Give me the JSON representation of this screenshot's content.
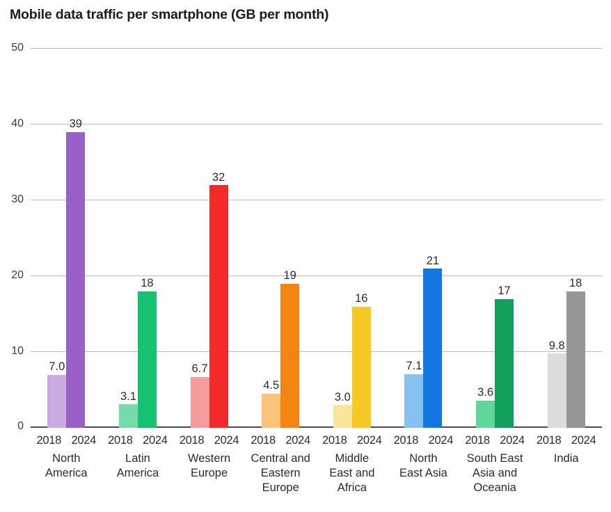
{
  "chart_data": {
    "type": "bar",
    "title": "Mobile data traffic per smartphone (GB per month)",
    "xlabel": "",
    "ylabel": "",
    "ylim": [
      0,
      50
    ],
    "yticks": [
      0,
      10,
      20,
      30,
      40,
      50
    ],
    "ytick_labels": [
      "0",
      "10",
      "20",
      "30",
      "40",
      "50"
    ],
    "grid": true,
    "legend": "none",
    "categories": [
      "North America",
      "Latin America",
      "Western Europe",
      "Central and Eastern Europe",
      "Middle East and Africa",
      "North East Asia",
      "South East Asia and Oceania",
      "India"
    ],
    "series": [
      {
        "name": "2018",
        "values": [
          7.0,
          3.1,
          6.7,
          4.5,
          3.0,
          7.1,
          3.6,
          9.8
        ],
        "labels": [
          "7.0",
          "3.1",
          "6.7",
          "4.5",
          "3.0",
          "7.1",
          "3.6",
          "9.8"
        ]
      },
      {
        "name": "2024",
        "values": [
          39,
          18,
          32,
          19,
          16,
          21,
          17,
          18
        ],
        "labels": [
          "39",
          "18",
          "32",
          "19",
          "16",
          "21",
          "17",
          "18"
        ]
      }
    ],
    "group_colors": [
      {
        "light": "#CBAAE2",
        "dark": "#9B5FC8"
      },
      {
        "light": "#74DCA8",
        "dark": "#16C172"
      },
      {
        "light": "#F79C9C",
        "dark": "#F42A28"
      },
      {
        "light": "#FBC27A",
        "dark": "#F58410"
      },
      {
        "light": "#FAE59B",
        "dark": "#F7C927"
      },
      {
        "light": "#85C2F0",
        "dark": "#1277E0"
      },
      {
        "light": "#62D69A",
        "dark": "#13A05C"
      },
      {
        "light": "#DCDCDC",
        "dark": "#969696"
      }
    ],
    "region_label_lines": [
      "North\nAmerica",
      "Latin\nAmerica",
      "Western\nEurope",
      "Central and\nEastern\nEurope",
      "Middle\nEast and\nAfrica",
      "North\nEast Asia",
      "South East\nAsia and\nOceania",
      "India"
    ]
  },
  "axis": {
    "gridline_color": "#b8b8b8",
    "zero_axis_color": "#4a4a4a"
  }
}
